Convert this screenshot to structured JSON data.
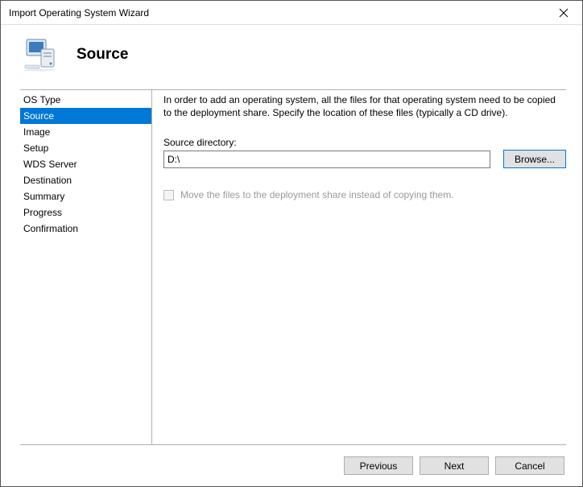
{
  "titlebar": {
    "text": "Import Operating System Wizard"
  },
  "header": {
    "title": "Source"
  },
  "sidebar": {
    "items": [
      {
        "label": "OS Type"
      },
      {
        "label": "Source"
      },
      {
        "label": "Image"
      },
      {
        "label": "Setup"
      },
      {
        "label": "WDS Server"
      },
      {
        "label": "Destination"
      },
      {
        "label": "Summary"
      },
      {
        "label": "Progress"
      },
      {
        "label": "Confirmation"
      }
    ],
    "selected_index": 1
  },
  "content": {
    "instruction": "In order to add an operating system, all the files for that operating system need to be copied to the deployment share.  Specify the location of these files (typically a CD drive).",
    "field_label": "Source directory:",
    "source_value": "D:\\",
    "browse_label": "Browse...",
    "move_checkbox_label": "Move the files to the deployment share instead of copying them."
  },
  "footer": {
    "previous": "Previous",
    "next": "Next",
    "cancel": "Cancel"
  }
}
